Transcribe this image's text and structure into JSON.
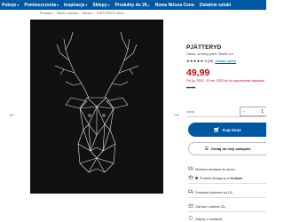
{
  "nav": {
    "items": [
      "Pokoje",
      "Pomieszczenia",
      "Inspiracje",
      "Sklepy",
      "Produkty do 26,-",
      "Nowa Niższa Cena",
      "Ostatnie sztuki"
    ]
  },
  "breadcrumb": [
    "Produkty",
    "Ramki i obrazki",
    "Obrazy",
    "PJÄTTERYD Obraz"
  ],
  "product": {
    "name": "PJÄTTERYD",
    "description": "Obraz, srebrny jeleń, 56x56 cm",
    "rating": "5 (19)",
    "reviews_link": "Zobacz opinie",
    "price": "49,99",
    "promo_note": "Od 1p, 2020 - 30 sie, 2020 lub do wyczerpania zapasów)",
    "old_price": "49,99"
  },
  "purchase": {
    "qty_label": "sztuk",
    "qty_minus": "-",
    "qty_value": "1",
    "buy_label": "Kup teraz",
    "list_label": "Dodaj do listy zakupów"
  },
  "availability": {
    "delivery": "Możliwa dostawa do domu",
    "store_prefix": "Produkt dostępny w",
    "store_name": "Krakow",
    "courier": "Dostawa kurierem za 15,-",
    "order_pickup": "Zamów i odbierz 25,-",
    "last": "Więcej o dostawie"
  },
  "colors": {
    "brand_blue": "#0058a3",
    "price_red": "#cc0008",
    "stock_green": "#0a8a00"
  }
}
